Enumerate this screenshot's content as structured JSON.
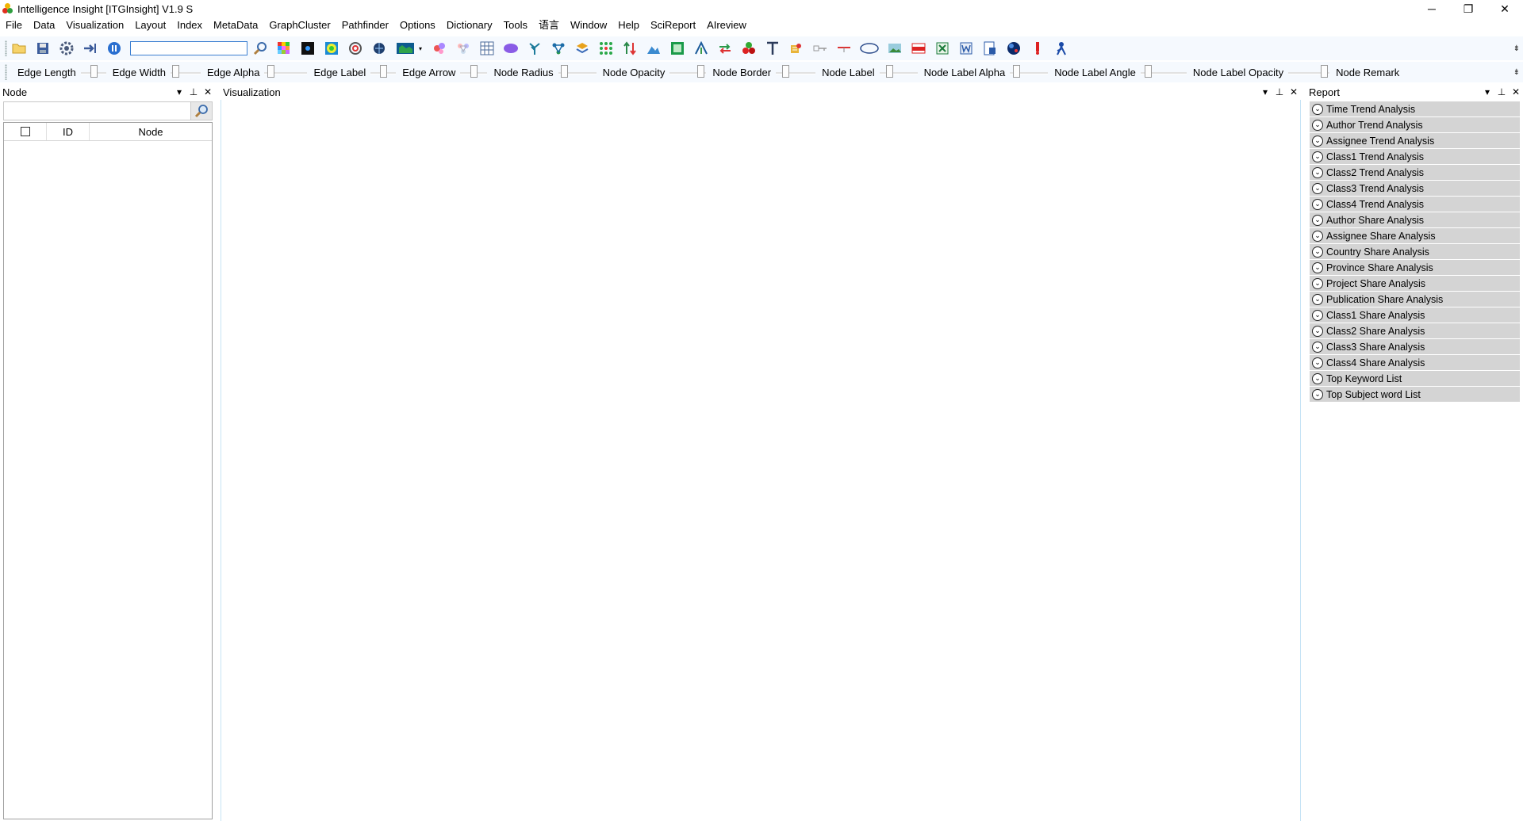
{
  "window": {
    "title": "Intelligence Insight [ITGInsight] V1.9 S",
    "controls": {
      "minimize": "─",
      "restore": "❐",
      "close": "✕"
    }
  },
  "menu": [
    "File",
    "Data",
    "Visualization",
    "Layout",
    "Index",
    "MetaData",
    "GraphCluster",
    "Pathfinder",
    "Options",
    "Dictionary",
    "Tools",
    "语言",
    "Window",
    "Help",
    "SciReport",
    "AIreview"
  ],
  "toolbar": {
    "search_value": "",
    "icons": [
      "open-folder-icon",
      "save-icon",
      "settings-gear-icon",
      "export-icon",
      "pause-icon",
      "search-input",
      "zoom-search-icon",
      "color-grid-icon",
      "black-square-icon",
      "color-ring-icon",
      "circle-layout-icon",
      "globe-icon",
      "map-icon",
      "dropdown-arrow-icon",
      "cluster-bubbles-icon",
      "network-icon",
      "table-grid-icon",
      "purple-blob-icon",
      "tree-icon",
      "graph-icon",
      "layers-icon",
      "dot-matrix-icon",
      "arrows-icon",
      "mountain-icon",
      "green-square-icon",
      "fan-icon",
      "swap-icon",
      "cherries-icon",
      "text-icon",
      "puzzle-icon",
      "key-icon",
      "line-icon",
      "ellipse-icon",
      "picture-icon",
      "pdf-icon",
      "excel-icon",
      "word-icon",
      "report-icon",
      "sphere-icon",
      "pin-icon",
      "person-icon"
    ]
  },
  "sliders": [
    {
      "label": "Edge Length",
      "pos": 0.5
    },
    {
      "label": "Edge Width",
      "pos": 0.08
    },
    {
      "label": "Edge Alpha",
      "pos": 0.08
    },
    {
      "label": "Edge Label",
      "pos": 0.5
    },
    {
      "label": "Edge Arrow",
      "pos": 0.5
    },
    {
      "label": "Node Radius",
      "pos": 0.08
    },
    {
      "label": "Node Opacity",
      "pos": 0.95
    },
    {
      "label": "Node Border",
      "pos": 0.2
    },
    {
      "label": "Node Label",
      "pos": 0.2
    },
    {
      "label": "Node Label Alpha",
      "pos": 0.1
    },
    {
      "label": "Node Label Angle",
      "pos": 0.1
    },
    {
      "label": "Node Label Opacity",
      "pos": 0.95
    },
    {
      "label": "Node Remark",
      "pos": 0.5
    }
  ],
  "node_panel": {
    "title": "Node",
    "search_value": "",
    "columns": [
      "",
      "ID",
      "Node"
    ],
    "rows": []
  },
  "viz_panel": {
    "title": "Visualization"
  },
  "report_panel": {
    "title": "Report",
    "items": [
      "Time Trend Analysis",
      "Author Trend Analysis",
      "Assignee Trend Analysis",
      "Class1 Trend Analysis",
      "Class2 Trend Analysis",
      "Class3 Trend Analysis",
      "Class4 Trend Analysis",
      "Author Share Analysis",
      "Assignee Share Analysis",
      "Country Share Analysis",
      "Province Share Analysis",
      "Project Share Analysis",
      "Publication Share Analysis",
      "Class1 Share Analysis",
      "Class2 Share Analysis",
      "Class3 Share Analysis",
      "Class4 Share Analysis",
      "Top Keyword List",
      "Top Subject word List"
    ]
  },
  "panel_controls": {
    "dropdown": "▾",
    "pin": "⊥",
    "close": "✕"
  }
}
